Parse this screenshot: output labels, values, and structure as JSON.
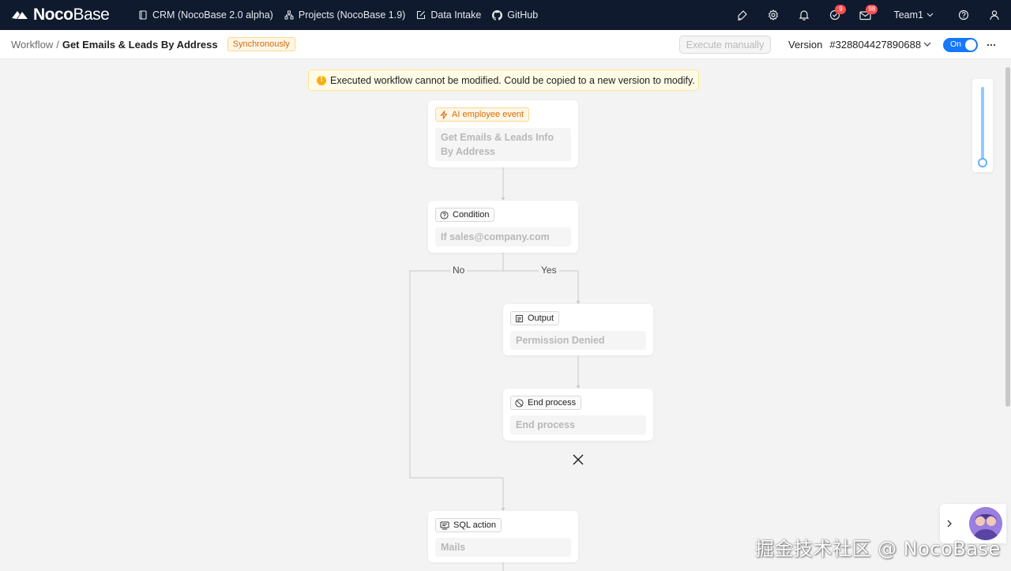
{
  "nav": {
    "brand_bold": "Noco",
    "brand_light": "Base",
    "links": [
      {
        "label": "CRM (NocoBase 2.0 alpha)",
        "icon": "book-icon"
      },
      {
        "label": "Projects (NocoBase 1.9)",
        "icon": "sitemap-icon"
      },
      {
        "label": "Data Intake",
        "icon": "edit-icon"
      },
      {
        "label": "GitHub",
        "icon": "github-icon"
      }
    ],
    "tasks_badge": "9",
    "mail_badge": "98",
    "team": "Team1"
  },
  "header": {
    "breadcrumb_root": "Workflow",
    "breadcrumb_sep": "/",
    "title": "Get Emails & Leads By Address",
    "sync_tag": "Synchronously",
    "execute_label": "Execute manually",
    "version_label": "Version",
    "version_id": "#328804427890688",
    "toggle_label": "On"
  },
  "canvas": {
    "alert": "Executed workflow cannot be modified. Could be copied to a new version to modify.",
    "trigger": {
      "type": "AI employee event",
      "title": "Get Emails & Leads Info By Address"
    },
    "condition": {
      "type": "Condition",
      "title": "If sales@company.com"
    },
    "branch_no": "No",
    "branch_yes": "Yes",
    "output": {
      "type": "Output",
      "title": "Permission Denied"
    },
    "end": {
      "type": "End process",
      "title": "End process"
    },
    "sql": {
      "type": "SQL action",
      "title": "Mails"
    },
    "zoom_level": 1.0
  },
  "watermark": "掘金技术社区 @ NocoBase",
  "colors": {
    "nav_bg": "#0f1a2e",
    "primary": "#1677ff",
    "warning": "#faad14"
  }
}
